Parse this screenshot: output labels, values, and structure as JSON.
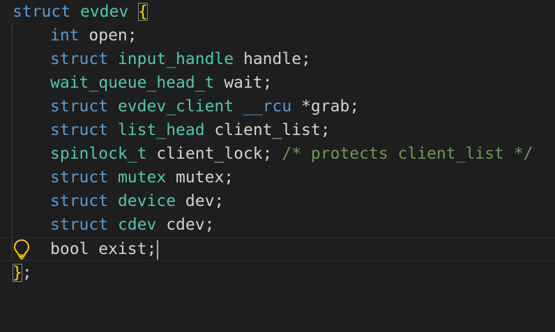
{
  "editor": {
    "lines": [
      {
        "tokens": [
          {
            "t": "struct",
            "c": "kw"
          },
          {
            "t": " ",
            "c": "pl"
          },
          {
            "t": "evdev",
            "c": "ty"
          },
          {
            "t": " ",
            "c": "pl"
          },
          {
            "t": "{",
            "c": "br"
          }
        ]
      },
      {
        "tokens": [
          {
            "t": "int",
            "c": "kw"
          },
          {
            "t": " open;",
            "c": "pl"
          }
        ]
      },
      {
        "tokens": [
          {
            "t": "struct",
            "c": "kw"
          },
          {
            "t": " ",
            "c": "pl"
          },
          {
            "t": "input_handle",
            "c": "ty"
          },
          {
            "t": " handle;",
            "c": "pl"
          }
        ]
      },
      {
        "tokens": [
          {
            "t": "wait_queue_head_t",
            "c": "ty"
          },
          {
            "t": " wait;",
            "c": "pl"
          }
        ]
      },
      {
        "tokens": [
          {
            "t": "struct",
            "c": "kw"
          },
          {
            "t": " ",
            "c": "pl"
          },
          {
            "t": "evdev_client",
            "c": "ty"
          },
          {
            "t": " ",
            "c": "pl"
          },
          {
            "t": "__rcu",
            "c": "macro"
          },
          {
            "t": " *grab;",
            "c": "pl"
          }
        ]
      },
      {
        "tokens": [
          {
            "t": "struct",
            "c": "kw"
          },
          {
            "t": " ",
            "c": "pl"
          },
          {
            "t": "list_head",
            "c": "ty"
          },
          {
            "t": " client_list;",
            "c": "pl"
          }
        ]
      },
      {
        "tokens": [
          {
            "t": "spinlock_t",
            "c": "ty"
          },
          {
            "t": " client_lock; ",
            "c": "pl"
          },
          {
            "t": "/* protects client_list */",
            "c": "cm"
          }
        ]
      },
      {
        "tokens": [
          {
            "t": "struct",
            "c": "kw"
          },
          {
            "t": " ",
            "c": "pl"
          },
          {
            "t": "mutex",
            "c": "ty"
          },
          {
            "t": " mutex;",
            "c": "pl"
          }
        ]
      },
      {
        "tokens": [
          {
            "t": "struct",
            "c": "kw"
          },
          {
            "t": " ",
            "c": "pl"
          },
          {
            "t": "device",
            "c": "ty"
          },
          {
            "t": " dev;",
            "c": "pl"
          }
        ]
      },
      {
        "tokens": [
          {
            "t": "struct",
            "c": "kw"
          },
          {
            "t": " ",
            "c": "pl"
          },
          {
            "t": "cdev",
            "c": "ty"
          },
          {
            "t": " cdev;",
            "c": "pl"
          }
        ]
      },
      {
        "tokens": [
          {
            "t": "bool exist;",
            "c": "pl"
          }
        ]
      },
      {
        "tokens": [
          {
            "t": "}",
            "c": "br"
          },
          {
            "t": ";",
            "c": "pl"
          }
        ]
      }
    ],
    "lightbulb_icon": "lightbulb-icon",
    "colors": {
      "background": "#1e1e1e",
      "keyword": "#569cd6",
      "type": "#4ec9b0",
      "plain": "#d4d4d4",
      "comment": "#6a9955",
      "bracket": "#ffd700",
      "lightbulb": "#ffcc00"
    }
  }
}
